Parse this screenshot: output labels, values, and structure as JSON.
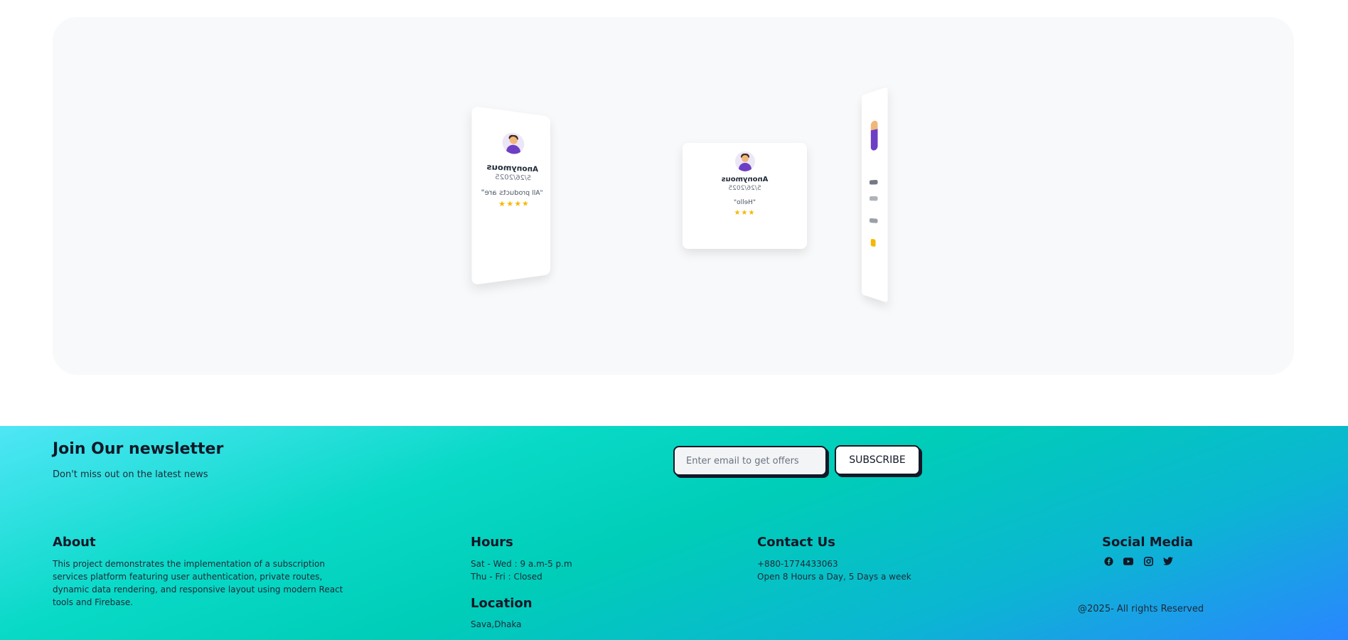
{
  "testimonials": {
    "left_card": {
      "name": "Anonymous",
      "date": "5/26/2025",
      "quote": "\"All products are\"",
      "stars": "★★★★"
    },
    "center_card": {
      "name": "Anonymous",
      "date": "5/26/2025",
      "quote": "\"Hello\"",
      "stars": "★★★"
    }
  },
  "newsletter": {
    "title": "Join Our newsletter",
    "subtitle": "Don't miss out on the latest news",
    "email_placeholder": "Enter email to get offers",
    "email_value": "",
    "subscribe_label": "SUBSCRIBE"
  },
  "about": {
    "title": "About",
    "text": "This project demonstrates the implementation of a subscription services platform featuring user authentication, private routes, dynamic data rendering, and responsive layout using modern React tools and Firebase."
  },
  "hours": {
    "title": "Hours",
    "line1": "Sat - Wed : 9 a.m-5 p.m",
    "line2": "Thu - Fri : Closed"
  },
  "location": {
    "title": "Location",
    "text": "Sava,Dhaka"
  },
  "contact": {
    "title": "Contact Us",
    "phone": "+880-1774433063",
    "availability": "Open 8 Hours a Day, 5 Days a week"
  },
  "social": {
    "title": "Social Media",
    "icons": [
      "facebook-icon",
      "youtube-icon",
      "instagram-icon",
      "twitter-icon"
    ],
    "copyright": "@2025- All rights Reserved"
  },
  "colors": {
    "star": "#f5b800",
    "footer_gradient_start": "#4fe6f6",
    "footer_gradient_mid": "#00cdb8",
    "footer_gradient_end": "#2a86ff",
    "avatar_shirt": "#6d3fc4"
  }
}
